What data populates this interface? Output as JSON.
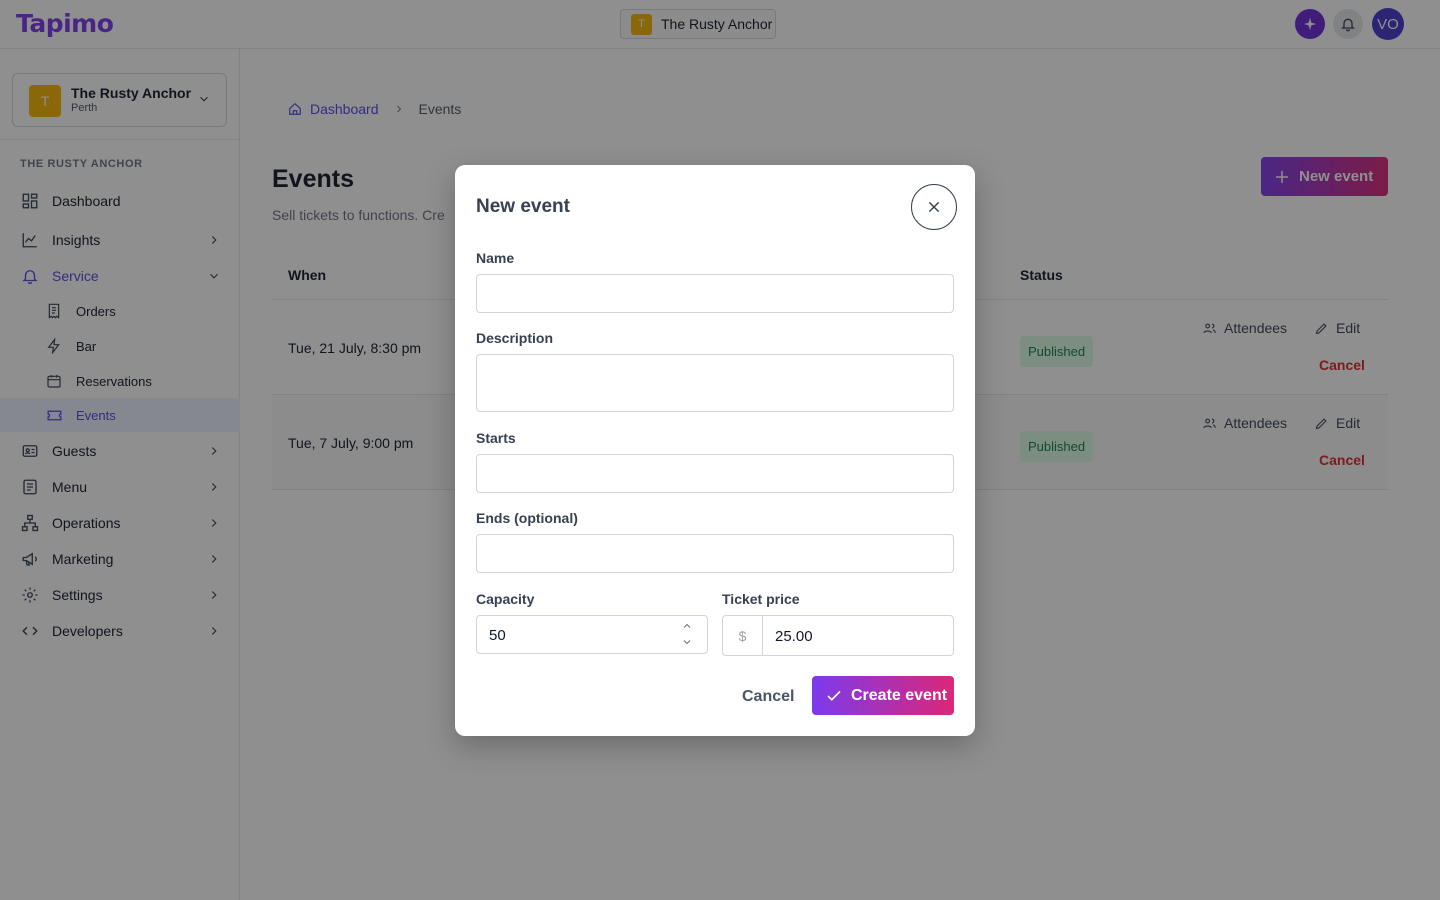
{
  "topbar": {
    "logo": "Tapimo",
    "venue_initial": "T",
    "venue_name": "The Rusty Anchor",
    "avatar_initials": "VO"
  },
  "sidebar": {
    "venue": {
      "initial": "T",
      "name": "The Rusty Anchor",
      "city": "Perth"
    },
    "section_title": "THE RUSTY ANCHOR",
    "items": [
      {
        "label": "Dashboard",
        "icon": "dashboard-icon"
      },
      {
        "label": "Insights",
        "icon": "chart-line-icon"
      },
      {
        "label": "Service",
        "icon": "bell-icon",
        "expanded": true
      },
      {
        "label": "Orders",
        "icon": "receipt-icon",
        "sub": true
      },
      {
        "label": "Bar",
        "icon": "bolt-icon",
        "sub": true
      },
      {
        "label": "Reservations",
        "icon": "calendar-icon",
        "sub": true
      },
      {
        "label": "Events",
        "icon": "ticket-icon",
        "sub": true,
        "active": true
      },
      {
        "label": "Guests",
        "icon": "id-card-icon"
      },
      {
        "label": "Menu",
        "icon": "document-icon"
      },
      {
        "label": "Operations",
        "icon": "org-chart-icon"
      },
      {
        "label": "Marketing",
        "icon": "megaphone-icon"
      },
      {
        "label": "Settings",
        "icon": "gear-icon"
      },
      {
        "label": "Developers",
        "icon": "code-icon"
      }
    ]
  },
  "main": {
    "breadcrumb": {
      "home": "Dashboard",
      "current": "Events"
    },
    "title": "Events",
    "subtitle": "Sell tickets to functions. Cre",
    "new_button": "New event",
    "table": {
      "headers": {
        "when": "When",
        "status": "Status"
      },
      "rows": [
        {
          "when": "Tue, 21 July, 8:30 pm",
          "status": "Published",
          "attendees": "Attendees",
          "edit": "Edit",
          "cancel": "Cancel"
        },
        {
          "when": "Tue, 7 July, 9:00 pm",
          "status": "Published",
          "attendees": "Attendees",
          "edit": "Edit",
          "cancel": "Cancel"
        }
      ]
    }
  },
  "modal": {
    "title": "New event",
    "fields": {
      "name_label": "Name",
      "name_value": "",
      "description_label": "Description",
      "description_value": "",
      "starts_label": "Starts",
      "starts_value": "",
      "ends_label": "Ends (optional)",
      "ends_value": "",
      "capacity_label": "Capacity",
      "capacity_value": "50",
      "price_label": "Ticket price",
      "price_currency": "$",
      "price_value": "25.00"
    },
    "cancel_label": "Cancel",
    "create_label": "Create event"
  },
  "colors": {
    "accent": "#4f46e5",
    "brand_gradient_start": "#7c3aed",
    "brand_gradient_end": "#db2777",
    "venue_yellow": "#f5b301",
    "published_bg": "#dcfce7",
    "published_text": "#15803d",
    "danger": "#dc2626"
  }
}
